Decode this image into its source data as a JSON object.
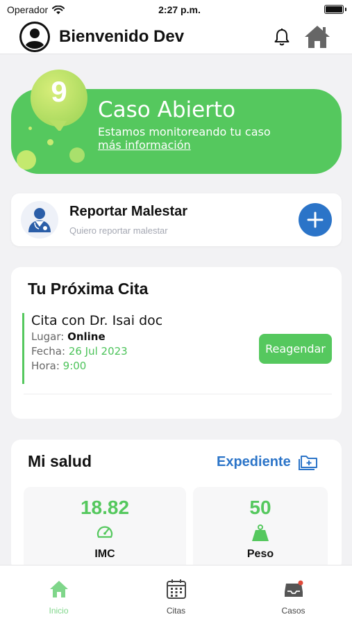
{
  "status_bar": {
    "carrier": "Operador",
    "time": "2:27 p.m."
  },
  "header": {
    "title": "Bienvenido Dev"
  },
  "case": {
    "count": "9",
    "title": "Caso Abierto",
    "subtitle": "Estamos monitoreando tu caso",
    "link": "más información"
  },
  "report": {
    "title": "Reportar Malestar",
    "subtitle": "Quiero reportar malestar"
  },
  "appointment": {
    "heading": "Tu Próxima Cita",
    "doctor": "Cita con Dr. Isai doc",
    "place_label": "Lugar:",
    "place_value": "Online",
    "date_label": "Fecha:",
    "date_value": "26 Jul 2023",
    "time_label": "Hora:",
    "time_value": "9:00",
    "reschedule_label": "Reagendar"
  },
  "health": {
    "title": "Mi salud",
    "record_link": "Expediente",
    "metrics": [
      {
        "value": "18.82",
        "label": "IMC",
        "icon": "gauge-icon"
      },
      {
        "value": "50",
        "label": "Peso",
        "icon": "weight-icon"
      }
    ]
  },
  "tabs": [
    {
      "label": "Inicio",
      "icon": "home-icon",
      "active": true
    },
    {
      "label": "Citas",
      "icon": "calendar-icon",
      "active": false
    },
    {
      "label": "Casos",
      "icon": "inbox-icon",
      "active": false
    }
  ],
  "colors": {
    "green": "#55c85e",
    "blue": "#2b74c8",
    "accent_dot": "#d7ee7a"
  }
}
